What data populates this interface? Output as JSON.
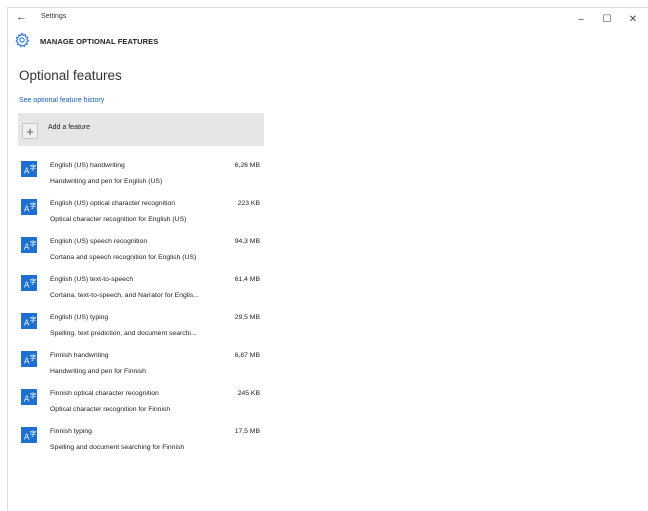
{
  "window": {
    "title": "Settings",
    "back_icon": "back-arrow-icon",
    "controls": {
      "minimize": "–",
      "maximize": "☐",
      "close": "✕"
    }
  },
  "header": {
    "icon": "gear-icon",
    "title": "MANAGE OPTIONAL FEATURES"
  },
  "page": {
    "title": "Optional features",
    "history_link": "See optional feature history",
    "add_feature": {
      "icon": "plus-icon",
      "label": "Add a feature"
    }
  },
  "features": [
    {
      "name": "English (US) handwriting",
      "size": "6,26 MB",
      "description": "Handwriting and pen for English (US)"
    },
    {
      "name": "English (US) optical character recognition",
      "size": "223 KB",
      "description": "Optical character recognition for English (US)"
    },
    {
      "name": "English (US) speech recognition",
      "size": "94,3 MB",
      "description": "Cortana and speech recognition for English (US)"
    },
    {
      "name": "English (US) text-to-speech",
      "size": "61,4 MB",
      "description": "Cortana, text-to-speech, and Narrator for Englis..."
    },
    {
      "name": "English (US) typing",
      "size": "29,5 MB",
      "description": "Spelling, text prediction, and document searchi..."
    },
    {
      "name": "Finnish handwriting",
      "size": "6,87 MB",
      "description": "Handwriting and pen for Finnish"
    },
    {
      "name": "Finnish optical character recognition",
      "size": "245 KB",
      "description": "Optical character recognition for Finnish"
    },
    {
      "name": "Finnish typing",
      "size": "17,5 MB",
      "description": "Spelling and document searching for Finnish"
    }
  ],
  "colors": {
    "accent": "#1f6fd0",
    "link": "#1a5fb4",
    "add_bg": "#e6e6e6"
  }
}
